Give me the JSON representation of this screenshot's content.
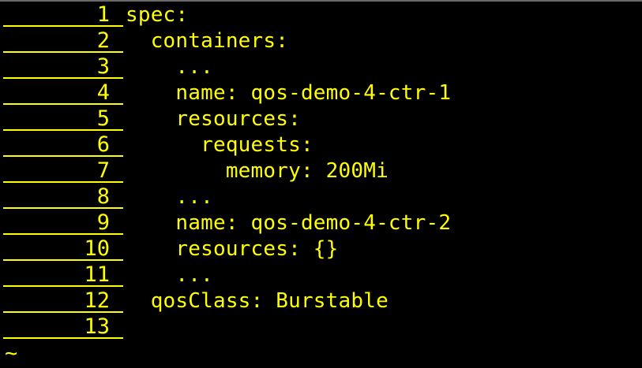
{
  "editor": {
    "lines": [
      {
        "number": "1",
        "text": "spec:"
      },
      {
        "number": "2",
        "text": "  containers:"
      },
      {
        "number": "3",
        "text": "    ..."
      },
      {
        "number": "4",
        "text": "    name: qos-demo-4-ctr-1"
      },
      {
        "number": "5",
        "text": "    resources:"
      },
      {
        "number": "6",
        "text": "      requests:"
      },
      {
        "number": "7",
        "text": "        memory: 200Mi"
      },
      {
        "number": "8",
        "text": "    ..."
      },
      {
        "number": "9",
        "text": "    name: qos-demo-4-ctr-2"
      },
      {
        "number": "10",
        "text": "    resources: {}"
      },
      {
        "number": "11",
        "text": "    ..."
      },
      {
        "number": "12",
        "text": "  qosClass: Burstable"
      },
      {
        "number": "13",
        "text": ""
      }
    ],
    "empty_line_marker": "~",
    "colors": {
      "background": "#000000",
      "foreground": "#ffff00"
    }
  }
}
